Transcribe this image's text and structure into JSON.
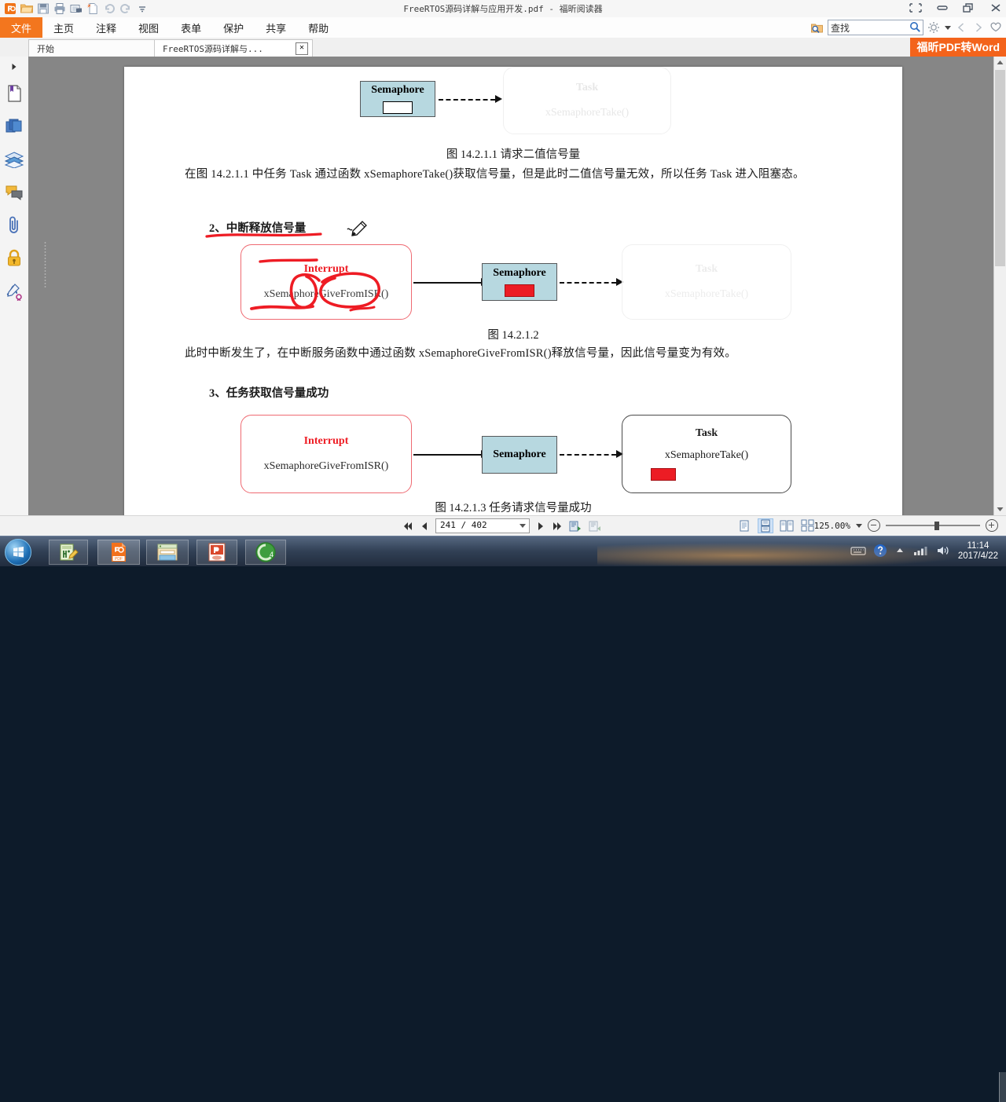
{
  "window": {
    "title": "FreeRTOS源码详解与应用开发.pdf - 福昕阅读器",
    "quick_access_icons": [
      "foxit-logo-icon",
      "open-folder-icon",
      "save-icon",
      "print-icon",
      "email-icon",
      "create-pdf-icon",
      "undo-icon",
      "redo-icon",
      "customize-toolbar-icon"
    ],
    "controls": [
      {
        "name": "fullscreen-toggle-button",
        "glyph": "fullscreen"
      },
      {
        "name": "minimize-button",
        "glyph": "minimize"
      },
      {
        "name": "restore-button",
        "glyph": "restore"
      },
      {
        "name": "close-button",
        "glyph": "close"
      }
    ]
  },
  "menu": {
    "items": [
      {
        "label": "文件",
        "active": true
      },
      {
        "label": "主页",
        "active": false
      },
      {
        "label": "注释",
        "active": false
      },
      {
        "label": "视图",
        "active": false
      },
      {
        "label": "表单",
        "active": false
      },
      {
        "label": "保护",
        "active": false
      },
      {
        "label": "共享",
        "active": false
      },
      {
        "label": "帮助",
        "active": false
      }
    ]
  },
  "search": {
    "placeholder": "查找",
    "value": "",
    "folder_search_icon": "folder-search-icon",
    "magnifier_icon": "search-icon",
    "settings_icon": "gear-icon",
    "dropdown_icon": "chevron-down-icon",
    "prev_icon": "find-previous-icon",
    "next_icon": "find-next-icon",
    "favorite_icon": "heart-icon"
  },
  "tabs": {
    "items": [
      {
        "label": "开始",
        "closable": false,
        "active": false
      },
      {
        "label": "FreeRTOS源码详解与...",
        "closable": true,
        "active": true,
        "close_label": "✕"
      }
    ],
    "overflow_icon": "chevron-down-icon",
    "promo_label": "福昕PDF转Word"
  },
  "sidebar": {
    "expand_icon": "expand-panel-icon",
    "items": [
      {
        "name": "sidebar-item-bookmarks",
        "icon": "bookmark-page-icon"
      },
      {
        "name": "sidebar-item-pages",
        "icon": "page-thumbnails-icon"
      },
      {
        "name": "sidebar-item-layers",
        "icon": "layers-icon"
      },
      {
        "name": "sidebar-item-comments",
        "icon": "comments-icon"
      },
      {
        "name": "sidebar-item-attachments",
        "icon": "paperclip-icon"
      },
      {
        "name": "sidebar-item-security",
        "icon": "lock-icon"
      },
      {
        "name": "sidebar-item-signatures",
        "icon": "signature-icon"
      }
    ]
  },
  "document": {
    "figure1": {
      "semaphore_label": "Semaphore",
      "task_title": "Task",
      "task_func": "xSemaphoreTake()",
      "caption": "图 14.2.1.1  请求二值信号量",
      "semaphore_filled": false,
      "task_dimmed": true
    },
    "paragraph1": "在图 14.2.1.1 中任务 Task 通过函数 xSemaphoreTake()获取信号量，但是此时二值信号量无效，所以任务 Task 进入阻塞态。",
    "heading2": "2、中断释放信号量",
    "figure2": {
      "interrupt_title": "Interrupt",
      "interrupt_func": "xSemaphoreGiveFromISR()",
      "semaphore_label": "Semaphore",
      "task_title": "Task",
      "task_func": "xSemaphoreTake()",
      "caption": "图 14.2.1.2",
      "semaphore_filled": true,
      "task_dimmed": true
    },
    "paragraph2": "此时中断发生了，在中断服务函数中通过函数 xSemaphoreGiveFromISR()释放信号量，因此信号量变为有效。",
    "heading3": "3、任务获取信号量成功",
    "figure3": {
      "interrupt_title": "Interrupt",
      "interrupt_func": "xSemaphoreGiveFromISR()",
      "semaphore_label": "Semaphore",
      "task_title": "Task",
      "task_func": "xSemaphoreTake()",
      "caption": "图 14.2.1.3  任务请求信号量成功",
      "semaphore_filled": false,
      "task_filled": true,
      "task_dimmed": false
    },
    "annotations": {
      "ink_color": "#ee1c24",
      "marks": [
        "underline-heading-2",
        "strikethrough-interrupt",
        "circle-give",
        "circle-from-isr",
        "underline-function"
      ]
    },
    "cursor_tool": "pencil-annotation-cursor"
  },
  "statusbar": {
    "first_page_icon": "first-page-icon",
    "prev_page_icon": "previous-page-icon",
    "page_current": "241",
    "page_separator": "/",
    "page_total": "402",
    "page_value": "241  /  402",
    "next_page_icon": "next-page-icon",
    "last_page_icon": "last-page-icon",
    "view_prev_icon": "previous-view-icon",
    "view_next_icon": "next-view-icon",
    "layout_buttons": [
      {
        "name": "single-page-view-button",
        "selected": false
      },
      {
        "name": "continuous-scroll-view-button",
        "selected": true
      },
      {
        "name": "facing-page-view-button",
        "selected": false
      },
      {
        "name": "continuous-facing-view-button",
        "selected": false
      }
    ],
    "zoom_level": "125.00%",
    "zoom_dropdown_icon": "chevron-down-icon",
    "zoom_out_icon": "zoom-out-icon",
    "zoom_in_icon": "zoom-in-icon"
  },
  "taskbar": {
    "start_label": "start-orb",
    "buttons": [
      {
        "name": "taskbar-notepadpp",
        "icon": "notepad-plus-plus-icon"
      },
      {
        "name": "taskbar-foxit-reader",
        "icon": "foxit-pdf-icon"
      },
      {
        "name": "taskbar-file-explorer",
        "icon": "file-explorer-icon"
      },
      {
        "name": "taskbar-powerpoint",
        "icon": "powerpoint-icon"
      },
      {
        "name": "taskbar-green-app",
        "icon": "green-globe-icon"
      }
    ],
    "tray": {
      "ime_icon": "keyboard-ime-icon",
      "help_icon": "help-icon",
      "hidden_icons_icon": "show-hidden-icons-icon",
      "network_icon": "network-signal-icon",
      "volume_icon": "volume-icon",
      "time": "11:14",
      "date": "2017/4/22"
    }
  }
}
